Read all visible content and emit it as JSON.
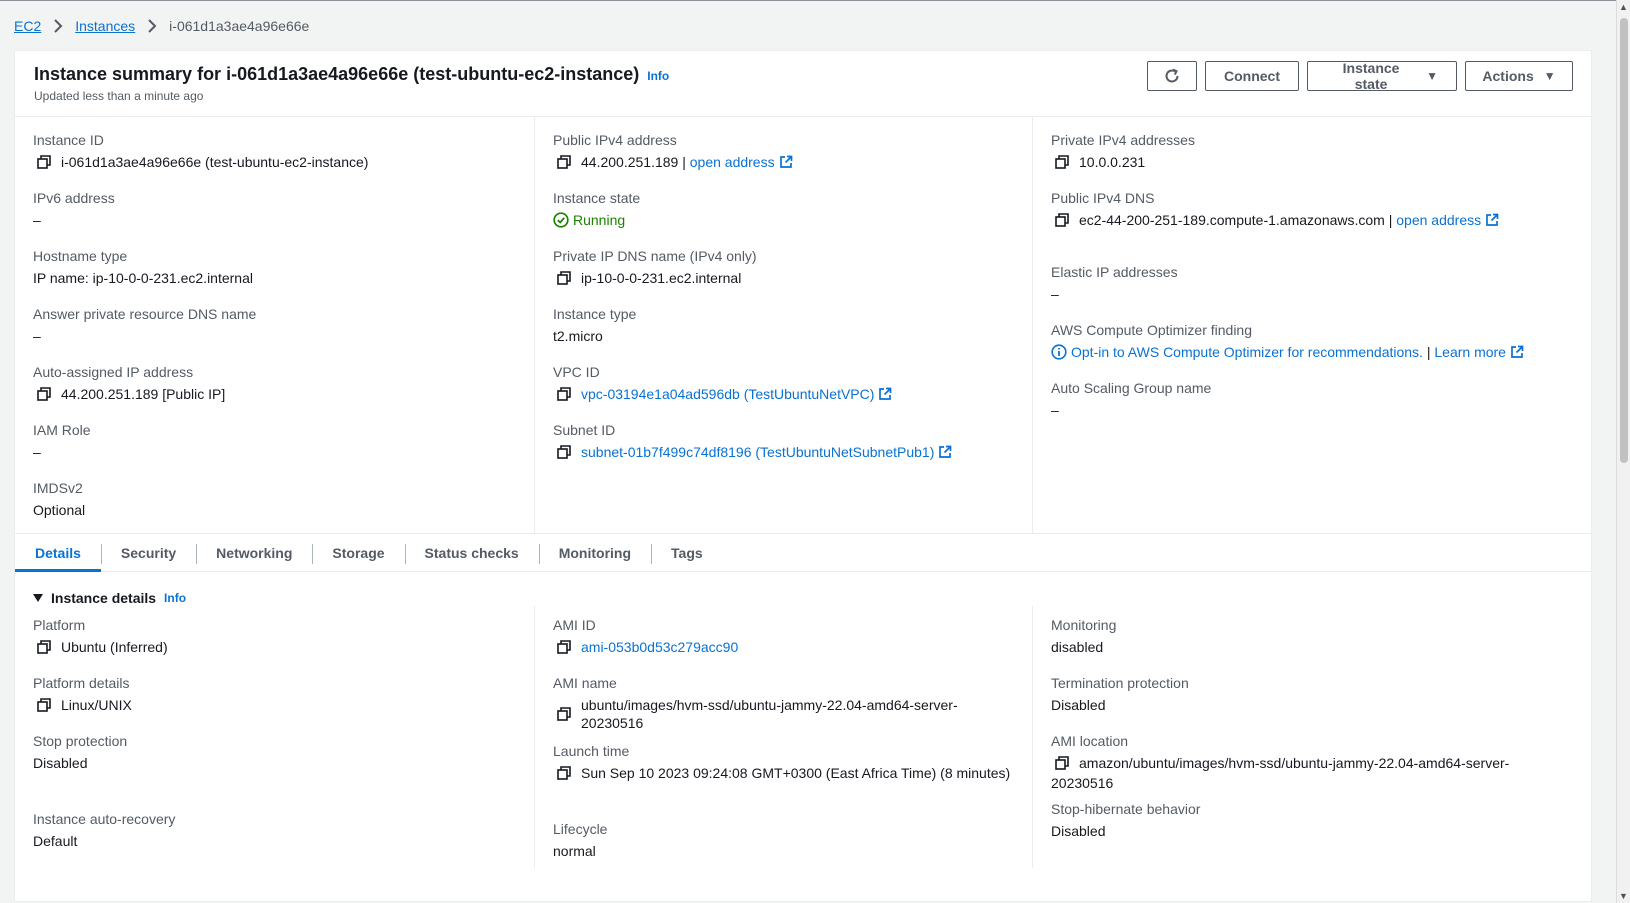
{
  "breadcrumb": {
    "items": [
      "EC2",
      "Instances"
    ],
    "current": "i-061d1a3ae4a96e66e"
  },
  "header": {
    "title": "Instance summary for i-061d1a3ae4a96e66e (test-ubuntu-ec2-instance)",
    "info": "Info",
    "subtitle": "Updated less than a minute ago",
    "buttons": {
      "connect": "Connect",
      "instance_state": "Instance state",
      "actions": "Actions"
    }
  },
  "summary": {
    "col1": [
      {
        "label": "Instance ID",
        "value": "i-061d1a3ae4a96e66e (test-ubuntu-ec2-instance)"
      },
      {
        "label": "IPv6 address",
        "value": "–"
      },
      {
        "label": "Hostname type",
        "value": "IP name: ip-10-0-0-231.ec2.internal"
      },
      {
        "label": "Answer private resource DNS name",
        "value": "–"
      },
      {
        "label": "Auto-assigned IP address",
        "value": "44.200.251.189 [Public IP]"
      },
      {
        "label": "IAM Role",
        "value": "–"
      },
      {
        "label": "IMDSv2",
        "value": "Optional"
      }
    ],
    "col2": [
      {
        "label": "Public IPv4 address",
        "value": "44.200.251.189",
        "sep": " | ",
        "link": "open address"
      },
      {
        "label": "Instance state",
        "value": "Running"
      },
      {
        "label": "Private IP DNS name (IPv4 only)",
        "value": "ip-10-0-0-231.ec2.internal"
      },
      {
        "label": "Instance type",
        "value": "t2.micro"
      },
      {
        "label": "VPC ID",
        "link": "vpc-03194e1a04ad596db (TestUbuntuNetVPC)"
      },
      {
        "label": "Subnet ID",
        "link": "subnet-01b7f499c74df8196 (TestUbuntuNetSubnetPub1)"
      }
    ],
    "col3": [
      {
        "label": "Private IPv4 addresses",
        "value": "10.0.0.231"
      },
      {
        "label": "Public IPv4 DNS",
        "value": "ec2-44-200-251-189.compute-1.amazonaws.com",
        "sep": " | ",
        "link": "open address"
      },
      {
        "label": "Elastic IP addresses",
        "value": "–"
      },
      {
        "label": "AWS Compute Optimizer finding",
        "link": "Opt-in to AWS Compute Optimizer for recommendations.",
        "sep": " | ",
        "link2": "Learn more"
      },
      {
        "label": "Auto Scaling Group name",
        "value": "–"
      }
    ]
  },
  "tabs": [
    "Details",
    "Security",
    "Networking",
    "Storage",
    "Status checks",
    "Monitoring",
    "Tags"
  ],
  "details": {
    "title": "Instance details",
    "info": "Info",
    "col1": [
      {
        "label": "Platform",
        "value": "Ubuntu (Inferred)"
      },
      {
        "label": "Platform details",
        "value": "Linux/UNIX"
      },
      {
        "label": "Stop protection",
        "value": "Disabled"
      },
      {
        "label": "Instance auto-recovery",
        "value": "Default"
      }
    ],
    "col2": [
      {
        "label": "AMI ID",
        "link": "ami-053b0d53c279acc90"
      },
      {
        "label": "AMI name",
        "value": "ubuntu/images/hvm-ssd/ubuntu-jammy-22.04-amd64-server-20230516"
      },
      {
        "label": "Launch time",
        "value": "Sun Sep 10 2023 09:24:08 GMT+0300 (East Africa Time) (8 minutes)"
      },
      {
        "label": "Lifecycle",
        "value": "normal"
      }
    ],
    "col3": [
      {
        "label": "Monitoring",
        "value": "disabled"
      },
      {
        "label": "Termination protection",
        "value": "Disabled"
      },
      {
        "label": "AMI location",
        "value": "amazon/ubuntu/images/hvm-ssd/ubuntu-jammy-22.04-amd64-server-",
        "value2": "20230516"
      },
      {
        "label": "Stop-hibernate behavior",
        "value": "Disabled"
      }
    ]
  },
  "colors": {
    "link": "#0972d3",
    "running": "#1d8102",
    "label": "#545b64"
  }
}
